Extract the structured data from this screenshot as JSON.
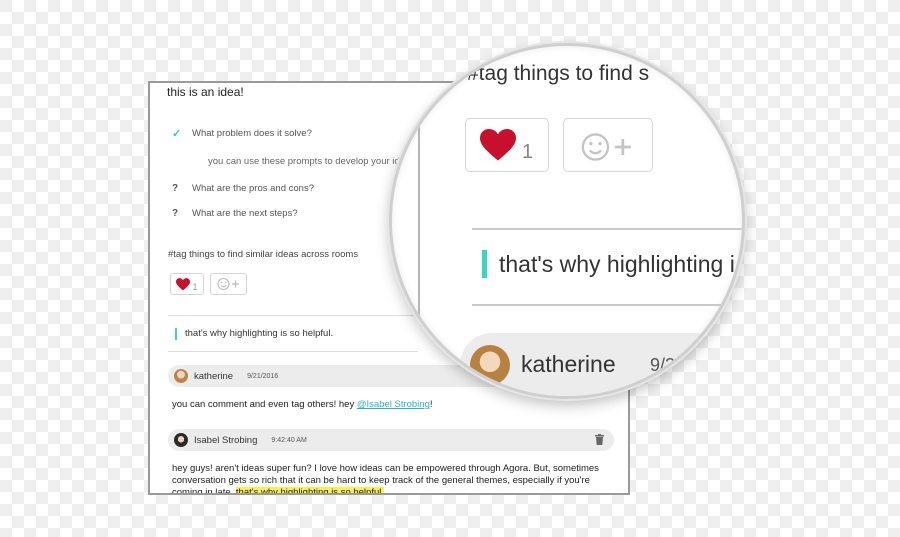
{
  "idea": {
    "title": "this is an idea!",
    "prompts": [
      {
        "mark": "✓",
        "text": "What problem does it solve?"
      },
      {
        "mark": "?",
        "text": "What are the pros and cons?"
      },
      {
        "mark": "?",
        "text": "What are the next steps?"
      }
    ],
    "helper_text": "you can use these prompts to develop your idea",
    "tag_text": "#tag things to find similar ideas across rooms",
    "reactions": {
      "like_count": "1"
    },
    "highlight_quote": "that's why highlighting is so helpful."
  },
  "comments": [
    {
      "author": "katherine",
      "date": "9/21/2016",
      "text_before": "you can comment and even tag others! hey ",
      "mention": "@Isabel Strobing",
      "text_after": "!"
    },
    {
      "author": "Isabel Strobing",
      "date": "9:42:40 AM",
      "text_line1": "hey guys! aren't ideas super fun? I love how ideas can be empowered through Agora. But, sometimes",
      "text_line2": "conversation gets so rich that it can be hard to keep track of the general themes, especially if you're",
      "text_line3": "coming in late. ",
      "highlighted": "that's why highlighting is so helpful."
    }
  ],
  "zoom": {
    "tag_text": "#tag things to find s",
    "like_count": "1",
    "quote": "that's why highlighting i",
    "author": "katherine",
    "date": "9/2"
  },
  "colors": {
    "accent": "#3dd4c4",
    "heart": "#c8102e",
    "highlight": "#f7f14c",
    "mention": "#2cb0c9"
  }
}
